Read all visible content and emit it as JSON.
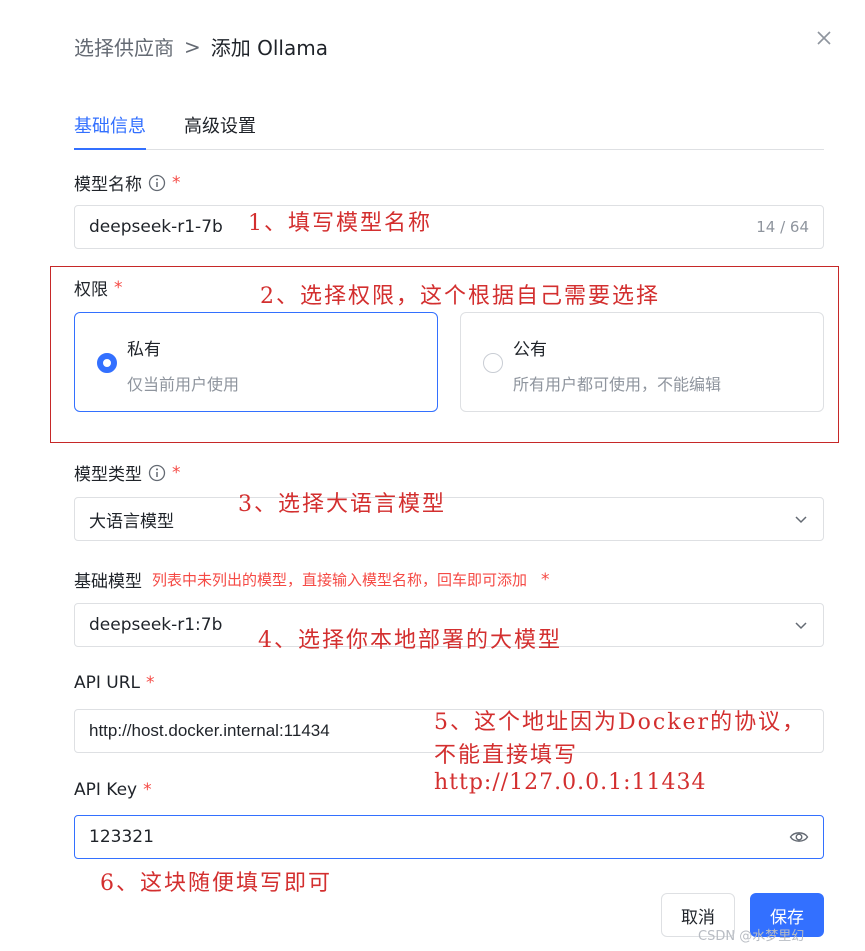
{
  "breadcrumb": {
    "parent": "选择供应商",
    "separator": ">",
    "current": "添加 Ollama"
  },
  "tabs": [
    {
      "label": "基础信息"
    },
    {
      "label": "高级设置"
    }
  ],
  "model_name": {
    "label": "模型名称",
    "required": "*",
    "value": "deepseek-r1-7b",
    "count": "14 / 64"
  },
  "permission": {
    "label": "权限",
    "required": "*",
    "options": [
      {
        "title": "私有",
        "desc": "仅当前用户使用",
        "selected": true
      },
      {
        "title": "公有",
        "desc": "所有用户都可使用，不能编辑",
        "selected": false
      }
    ]
  },
  "model_type": {
    "label": "模型类型",
    "required": "*",
    "value": "大语言模型"
  },
  "base_model": {
    "label": "基础模型",
    "hint": "列表中未列出的模型，直接输入模型名称，回车即可添加",
    "required": "*",
    "value": "deepseek-r1:7b"
  },
  "api_url": {
    "label": "API URL",
    "required": "*",
    "value": "http://host.docker.internal:11434"
  },
  "api_key": {
    "label": "API Key",
    "required": "*",
    "value": "123321"
  },
  "buttons": {
    "cancel": "取消",
    "save": "保存"
  },
  "annotations": {
    "a1": "1、填写模型名称",
    "a2": "2、选择权限，这个根据自己需要选择",
    "a3": "3、选择大语言模型",
    "a4": "4、选择你本地部署的大模型",
    "a5_line1": "5、这个地址因为Docker的协议，",
    "a5_line2": "不能直接填写",
    "a5_line3": "http://127.0.0.1:11434",
    "a6": "6、这块随便填写即可"
  },
  "watermark": "CSDN @水梦里幻",
  "colors": {
    "accent": "#3370ff",
    "required": "#f54a45",
    "annotation": "#d32f2f"
  }
}
